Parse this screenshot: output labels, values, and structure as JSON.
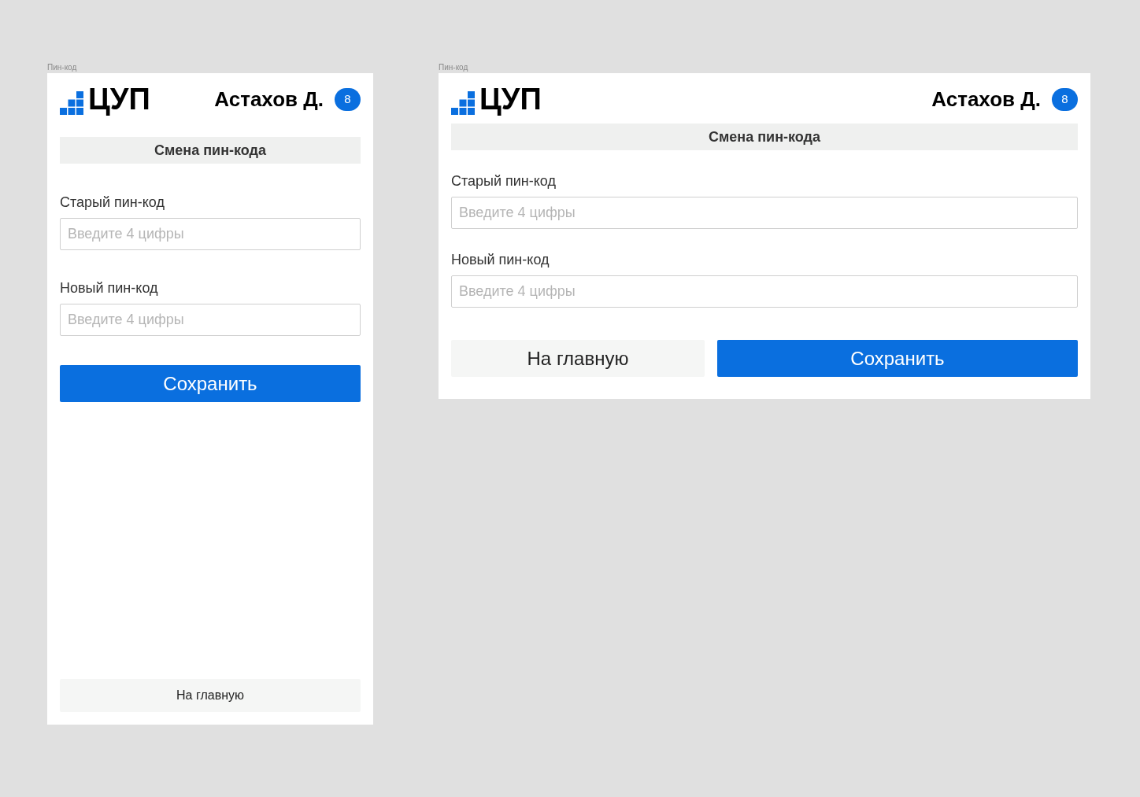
{
  "frames": [
    {
      "kind": "mobile",
      "frame_label": "Пин-код",
      "logo": "ЦУП",
      "user": "Астахов Д.",
      "badge": "8",
      "title": "Смена пин-кода",
      "fields": [
        {
          "label": "Старый пин-код",
          "placeholder": "Введите 4 цифры"
        },
        {
          "label": "Новый пин-код",
          "placeholder": "Введите 4 цифры"
        }
      ],
      "buttons": [
        {
          "kind": "primary",
          "label": "Сохранить"
        },
        {
          "kind": "secondary",
          "label": "На главную"
        }
      ]
    },
    {
      "kind": "desktop",
      "frame_label": "Пин-код",
      "logo": "ЦУП",
      "user": "Астахов Д.",
      "badge": "8",
      "title": "Смена пин-кода",
      "fields": [
        {
          "label": "Старый пин-код",
          "placeholder": "Введите 4 цифры"
        },
        {
          "label": "Новый пин-код",
          "placeholder": "Введите 4 цифры"
        }
      ],
      "buttons": [
        {
          "kind": "secondary",
          "label": "На главную"
        },
        {
          "kind": "primary",
          "label": "Сохранить"
        }
      ]
    }
  ]
}
